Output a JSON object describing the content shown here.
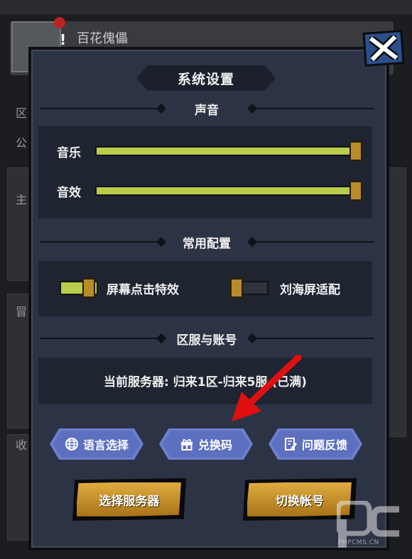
{
  "background": {
    "player_name": "百花傀儡",
    "alert_mark": "!",
    "left_labels": [
      "区",
      "公",
      "主",
      "冒",
      "收"
    ]
  },
  "modal": {
    "title": "系统设置",
    "close_icon": "close-x-icon",
    "sound": {
      "title": "声音",
      "music_label": "音乐",
      "music_level": 1.0,
      "sfx_label": "音效",
      "sfx_level": 1.0
    },
    "common": {
      "title": "常用配置",
      "tap_effect_label": "屏幕点击特效",
      "tap_effect_on": true,
      "notch_label": "刘海屏适配",
      "notch_on": false
    },
    "account": {
      "title": "区服与账号",
      "current_server": "当前服务器: 归来1区-归来5服 (已满)"
    },
    "buttons": {
      "language": "语言选择",
      "redeem": "兑换码",
      "feedback": "问题反馈",
      "select_server": "选择服务器",
      "switch_account": "切换帐号"
    }
  },
  "watermark": {
    "text": "PHPCMS.CN"
  },
  "colors": {
    "slider_fill": "#b9cd4a",
    "knob": "#b88b2d",
    "hex_button": "#5d6fbf",
    "gold_button": "#d59a30",
    "arrow": "#e01010"
  }
}
